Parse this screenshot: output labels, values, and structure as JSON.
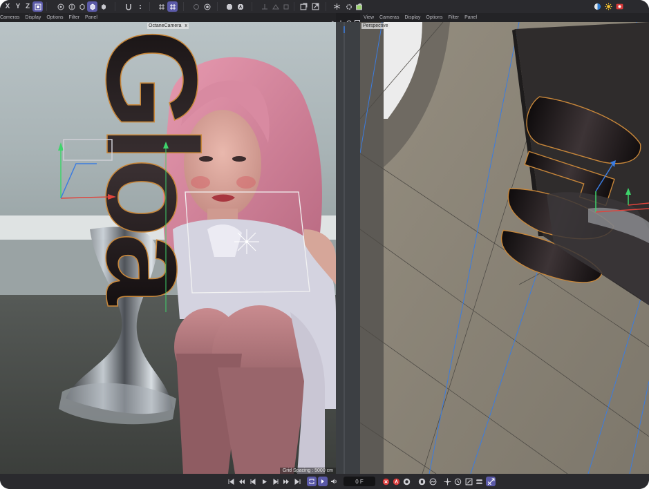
{
  "toolbar": {
    "axis_x": "X",
    "axis_y": "Y",
    "axis_z": "Z"
  },
  "left_viewport": {
    "menu": [
      "Cameras",
      "Display",
      "Options",
      "Filter",
      "Panel"
    ],
    "camera_tag": "OctaneCamera",
    "camera_tag_close": "x",
    "grid_spacing": "Grid Spacing : 5000 cm",
    "overlay_text": "Gloa"
  },
  "right_viewport": {
    "menu": [
      "View",
      "Cameras",
      "Display",
      "Options",
      "Filter",
      "Panel"
    ],
    "label": "Perspective"
  },
  "timeline": {
    "frame": "0 F"
  },
  "colors": {
    "accent": "#5b5aa8",
    "background": "#1e1e21",
    "panel": "#2a2a2e",
    "record": "#e45050"
  }
}
